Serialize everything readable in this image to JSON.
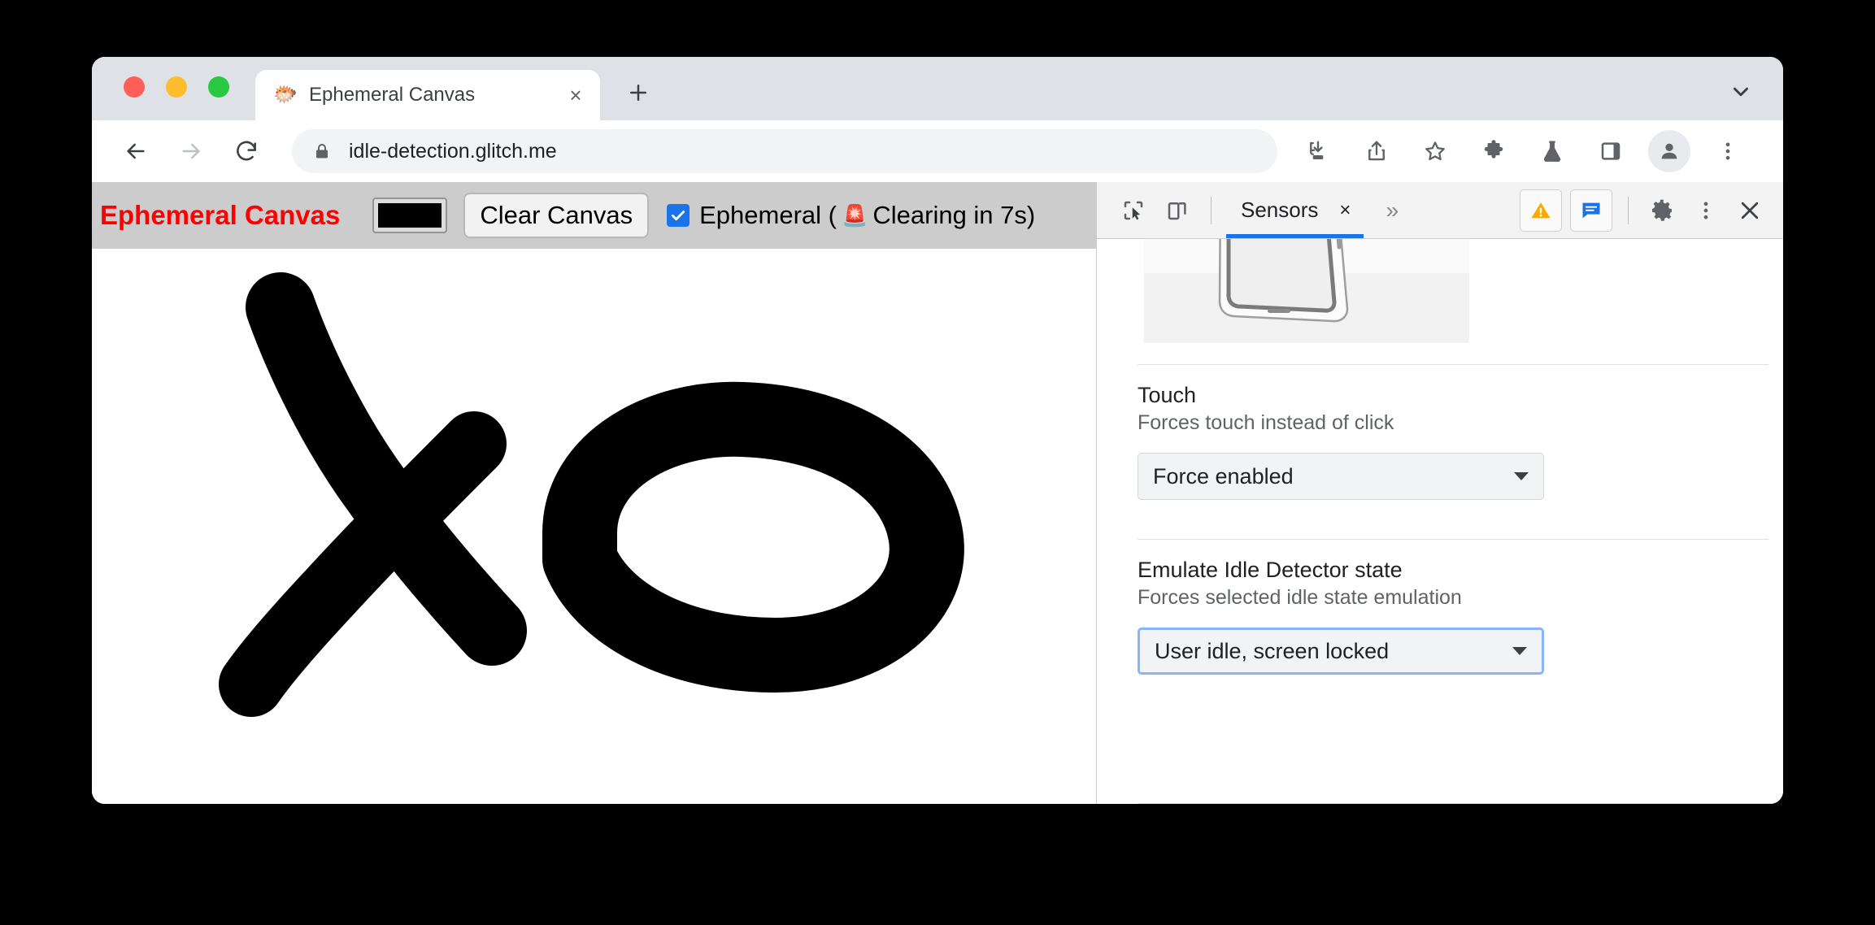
{
  "browser": {
    "traffic_lights": [
      {
        "name": "close",
        "color": "#ff5f57"
      },
      {
        "name": "minimize",
        "color": "#febc2e"
      },
      {
        "name": "maximize",
        "color": "#28c840"
      }
    ],
    "tab": {
      "title": "Ephemeral Canvas",
      "favicon": "🐡",
      "close_label": "×"
    },
    "new_tab_label": "+",
    "tab_search_icon": "chevron-down-icon",
    "omnibox": {
      "url": "idle-detection.glitch.me",
      "lock_icon": "lock-icon"
    },
    "nav": {
      "back_icon": "back-arrow-icon",
      "forward_icon": "forward-arrow-icon",
      "reload_icon": "reload-icon"
    },
    "toolbar_icons": [
      "download-icon",
      "share-icon",
      "bookmark-star-icon",
      "extensions-puzzle-icon",
      "experiments-flask-icon",
      "side-panel-icon",
      "profile-avatar-icon",
      "browser-menu-icon"
    ]
  },
  "page": {
    "site_title": "Ephemeral Canvas",
    "site_title_color": "#ff0000",
    "color_value": "#000000",
    "clear_canvas_label": "Clear Canvas",
    "ephemeral": {
      "checked": true,
      "label_before": "Ephemeral (",
      "alarm_emoji": "🚨",
      "label_after": "Clearing in 7s)",
      "full_label": "Ephemeral (🚨 Clearing in 7s)",
      "seconds_remaining": "7s"
    },
    "canvas": {
      "background": "#ffffff",
      "stroke_color": "#000000",
      "description": "freehand black brush drawing resembling an X crossed with an O"
    },
    "header_background": "#cccccc"
  },
  "devtools": {
    "toolbar": {
      "inspect_icon": "inspect-element-icon",
      "device_toggle_icon": "device-toolbar-icon",
      "tab_label": "Sensors",
      "tab_close_label": "×",
      "more_tabs_label": "»",
      "warning_badge_icon": "warning-triangle-icon",
      "console_badge_icon": "console-message-icon",
      "settings_icon": "gear-icon",
      "menu_icon": "devtools-menu-icon",
      "close_icon": "close-icon",
      "active_tab_accent": "#1a73e8"
    },
    "orientation_widget": {
      "name": "device-orientation-preview"
    },
    "sections": [
      {
        "id": "touch",
        "title": "Touch",
        "subtitle": "Forces touch instead of click",
        "select_value": "Force enabled",
        "focused": false
      },
      {
        "id": "idle-detector",
        "title": "Emulate Idle Detector state",
        "subtitle": "Forces selected idle state emulation",
        "select_value": "User idle, screen locked",
        "focused": true
      }
    ]
  }
}
